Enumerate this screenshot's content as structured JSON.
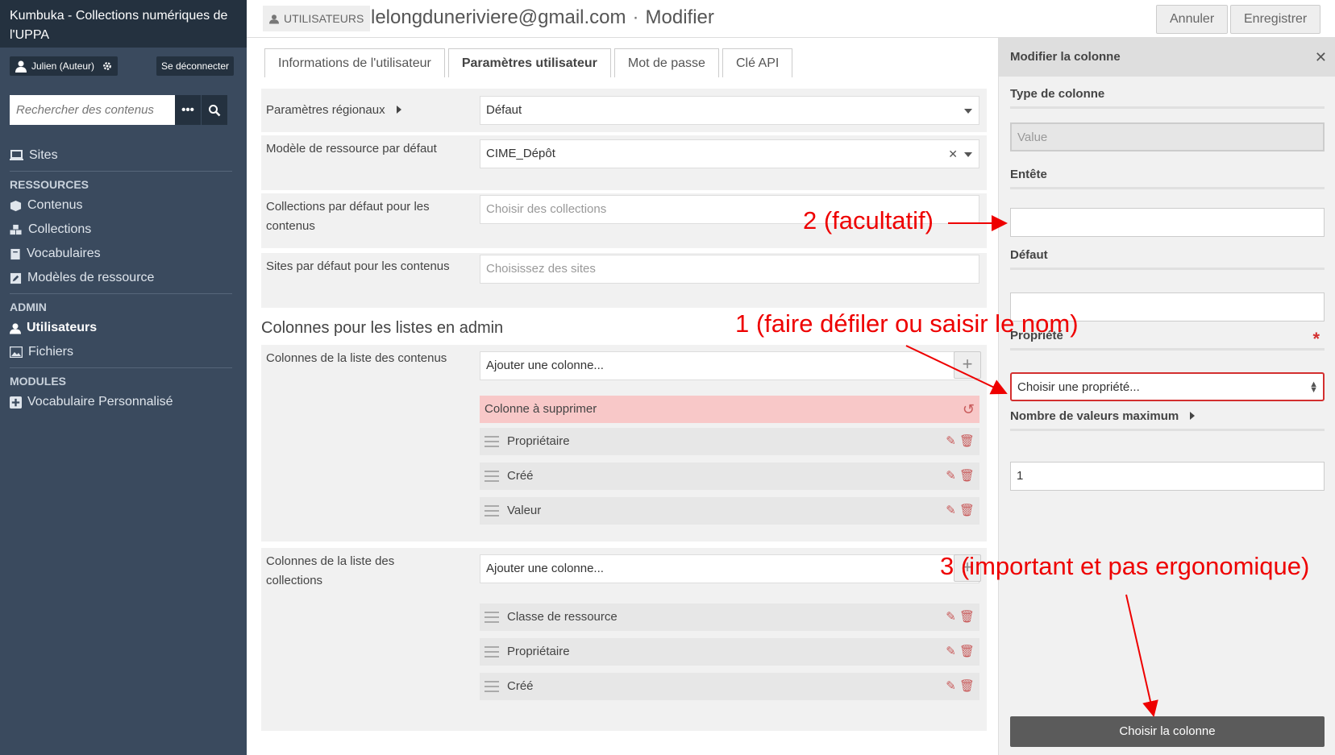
{
  "sidebar": {
    "brand": "Kumbuka - Collections numériques de l'UPPA",
    "user_label": "Julien (Auteur)",
    "logout_label": "Se déconnecter",
    "search_placeholder": "Rechercher des contenus",
    "items": {
      "sites": "Sites",
      "section_ressources": "RESSOURCES",
      "contenus": "Contenus",
      "collections": "Collections",
      "vocabulaires": "Vocabulaires",
      "modeles": "Modèles de ressource",
      "section_admin": "ADMIN",
      "utilisateurs": "Utilisateurs",
      "fichiers": "Fichiers",
      "section_modules": "MODULES",
      "vocab_perso": "Vocabulaire Personnalisé"
    }
  },
  "header": {
    "tag": "UTILISATEURS",
    "email": "lelongduneriviere@gmail.com",
    "separator": "·",
    "action": "Modifier",
    "cancel_label": "Annuler",
    "save_label": "Enregistrer"
  },
  "tabs": [
    "Informations de l'utilisateur",
    "Paramètres utilisateur",
    "Mot de passe",
    "Clé API"
  ],
  "form": {
    "regional_label": "Paramètres régionaux",
    "regional_value": "Défaut",
    "template_label": "Modèle de ressource par défaut",
    "template_value": "CIME_Dépôt",
    "collections_label": "Collections par défaut pour les contenus",
    "collections_placeholder": "Choisir des collections",
    "sites_label": "Sites par défaut pour les contenus",
    "sites_placeholder": "Choisissez des sites",
    "columns_heading": "Colonnes pour les listes en admin",
    "items_columns_label": "Colonnes de la liste des contenus",
    "add_column_placeholder": "Ajouter une colonne...",
    "deleted_column": "Colonne à supprimer",
    "items_columns": [
      "Propriétaire",
      "Créé",
      "Valeur"
    ],
    "collections_columns_label": "Colonnes de la liste des collections",
    "collections_columns": [
      "Classe de ressource",
      "Propriétaire",
      "Créé"
    ]
  },
  "panel": {
    "title": "Modifier la colonne",
    "type_label": "Type de colonne",
    "type_value": "Value",
    "header_label": "Entête",
    "default_label": "Défaut",
    "property_label": "Propriété",
    "required_mark": "*",
    "property_placeholder": "Choisir une propriété...",
    "max_values_label": "Nombre de valeurs maximum",
    "max_values_value": "1",
    "submit_label": "Choisir la colonne"
  },
  "annotations": {
    "a1": "1 (faire défiler ou saisir le nom)",
    "a2": "2 (facultatif)",
    "a3": "3 (important et pas ergonomique)"
  },
  "colors": {
    "sidebar_bg": "#3a4a5e",
    "sidebar_dark": "#24313f",
    "danger_row": "#f8c8c8",
    "annotation": "#ee0000",
    "submit_bg": "#5b5b5b"
  }
}
